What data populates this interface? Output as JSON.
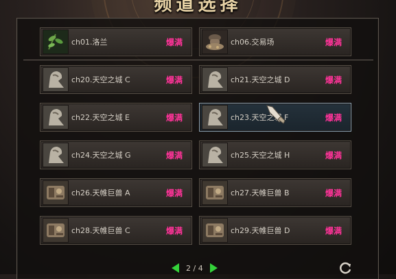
{
  "window": {
    "title": "频道选择"
  },
  "channels_top": [
    {
      "name": "ch01.洛兰",
      "status": "爆满",
      "icon": "plant-icon"
    },
    {
      "name": "ch06.交易场",
      "status": "爆满",
      "icon": "merchant-icon"
    }
  ],
  "channels": [
    {
      "name": "ch20.天空之城 C",
      "status": "爆满",
      "icon": "statue-icon"
    },
    {
      "name": "ch21.天空之城 D",
      "status": "爆满",
      "icon": "statue-icon"
    },
    {
      "name": "ch22.天空之城 E",
      "status": "爆满",
      "icon": "statue-icon"
    },
    {
      "name": "ch23.天空之城 F",
      "status": "爆满",
      "icon": "statue-icon"
    },
    {
      "name": "ch24.天空之城 G",
      "status": "爆满",
      "icon": "statue-icon"
    },
    {
      "name": "ch25.天空之城 H",
      "status": "爆满",
      "icon": "statue-icon"
    },
    {
      "name": "ch26.天帷巨兽 A",
      "status": "爆满",
      "icon": "beast-icon"
    },
    {
      "name": "ch27.天帷巨兽 B",
      "status": "爆满",
      "icon": "beast-icon"
    },
    {
      "name": "ch28.天帷巨兽 C",
      "status": "爆满",
      "icon": "beast-icon"
    },
    {
      "name": "ch29.天帷巨兽 D",
      "status": "爆满",
      "icon": "beast-icon"
    }
  ],
  "selected_channel": "ch23.天空之城 F",
  "pager": {
    "text": "2 / 4"
  },
  "colors": {
    "status": "#ff3399",
    "arrow": "#34d23a",
    "text": "#d6d0c6",
    "selected_outline": "#8ea4b4"
  }
}
